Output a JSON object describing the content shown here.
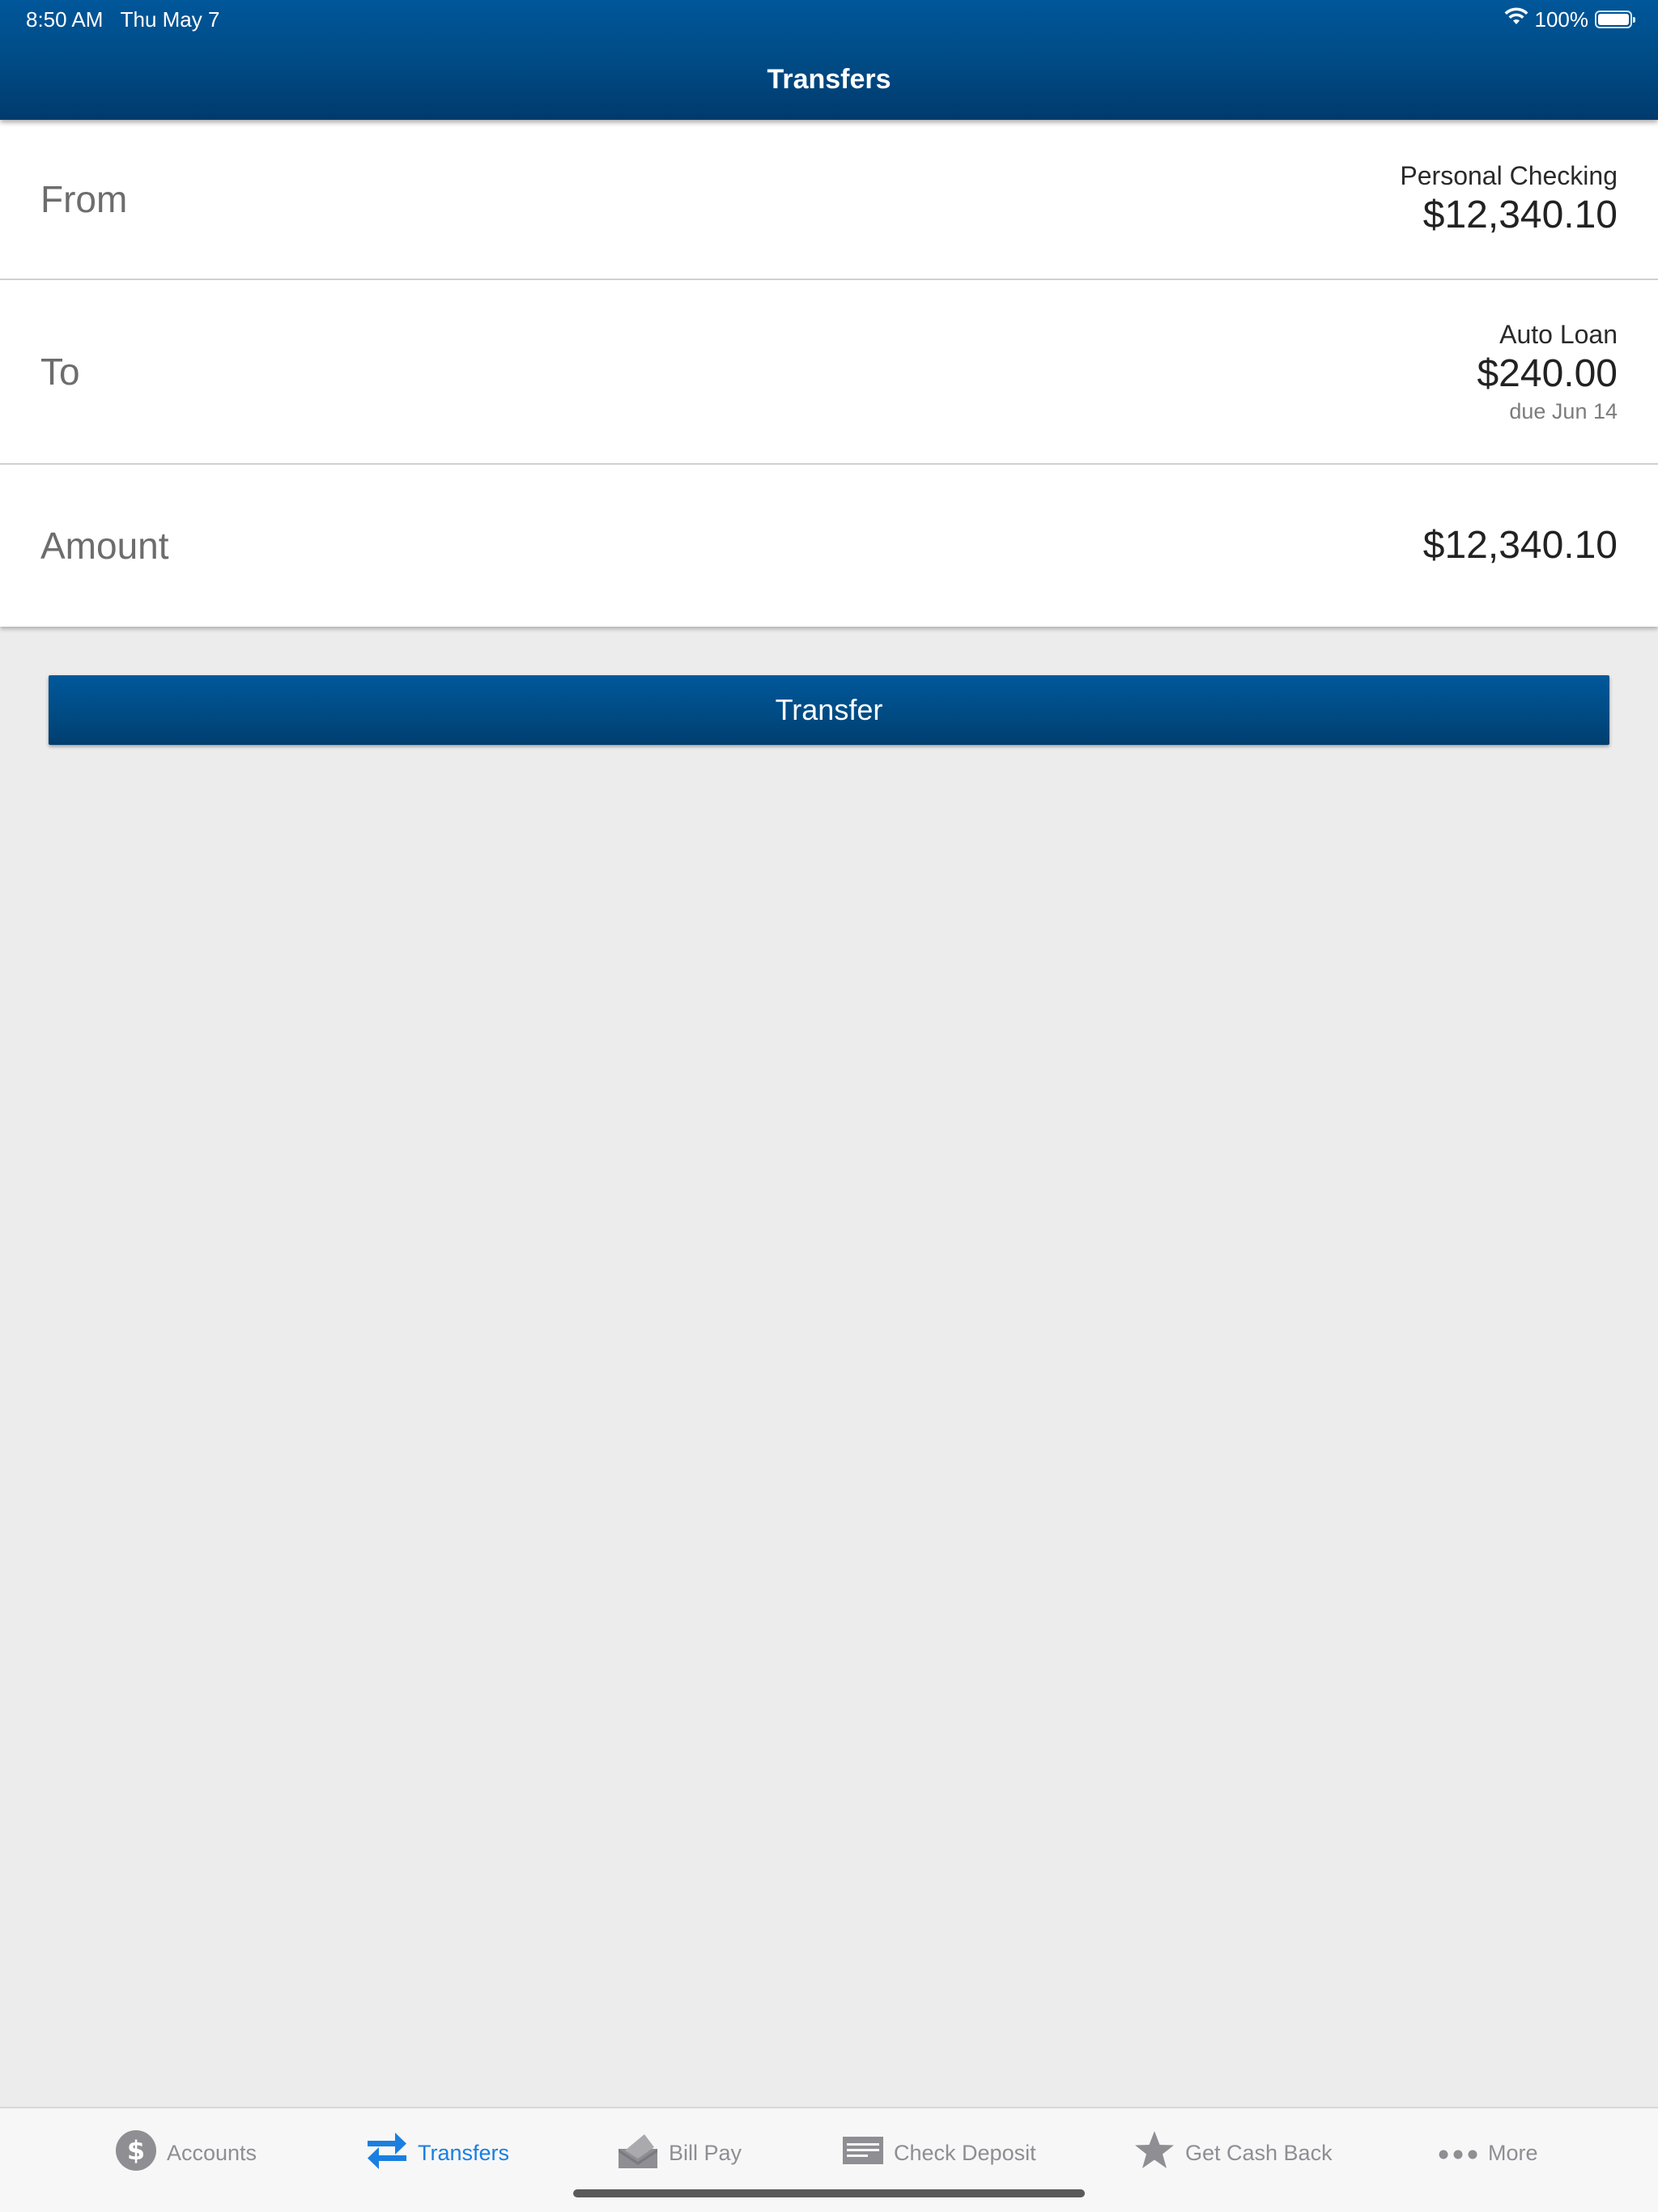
{
  "status_bar": {
    "time": "8:50 AM",
    "date": "Thu May 7",
    "battery_percent": "100%",
    "battery_level": 1.0,
    "icons": [
      "wifi-icon",
      "battery-icon"
    ]
  },
  "header": {
    "title": "Transfers"
  },
  "form": {
    "from": {
      "label": "From",
      "account_name": "Personal Checking",
      "balance": "$12,340.10"
    },
    "to": {
      "label": "To",
      "account_name": "Auto Loan",
      "amount": "$240.00",
      "due": "due Jun 14"
    },
    "amount": {
      "label": "Amount",
      "value": "$12,340.10"
    }
  },
  "actions": {
    "transfer_label": "Transfer"
  },
  "tabbar": {
    "active_tab": "Transfers",
    "items": [
      {
        "label": "Accounts",
        "icon": "dollar-circle-icon"
      },
      {
        "label": "Transfers",
        "icon": "transfer-arrows-icon"
      },
      {
        "label": "Bill Pay",
        "icon": "bill-envelope-icon"
      },
      {
        "label": "Check Deposit",
        "icon": "check-icon"
      },
      {
        "label": "Get Cash Back",
        "icon": "star-icon"
      },
      {
        "label": "More",
        "icon": "more-dots-icon"
      }
    ]
  },
  "colors": {
    "brand_blue": "#004a84",
    "active_tab": "#1a7fe0",
    "inactive_tab": "#8e8e93",
    "background": "#ececec"
  }
}
